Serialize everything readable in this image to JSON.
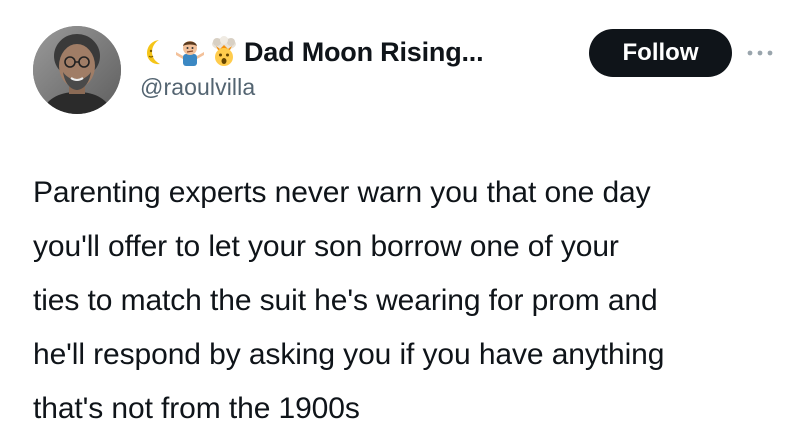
{
  "tweet": {
    "author": {
      "display_name": "Dad Moon Rising...",
      "handle": "@raoulvilla",
      "name_emojis": [
        "crescent-moon-emoji",
        "man-shrugging-emoji",
        "exploding-head-emoji"
      ],
      "avatar": "profile-photo"
    },
    "follow_label": "Follow",
    "more_icon": "more-options-icon",
    "text_lines": [
      "Parenting experts never warn you that one day",
      "you'll offer to let your son borrow one of your",
      "ties to match the suit he's wearing for prom and",
      "he'll respond by asking you if you have anything",
      "that's not from the 1900s"
    ]
  },
  "colors": {
    "text": "#0f1419",
    "secondary_text": "#536471",
    "follow_bg": "#0f1419",
    "follow_text": "#ffffff",
    "background": "#ffffff"
  }
}
